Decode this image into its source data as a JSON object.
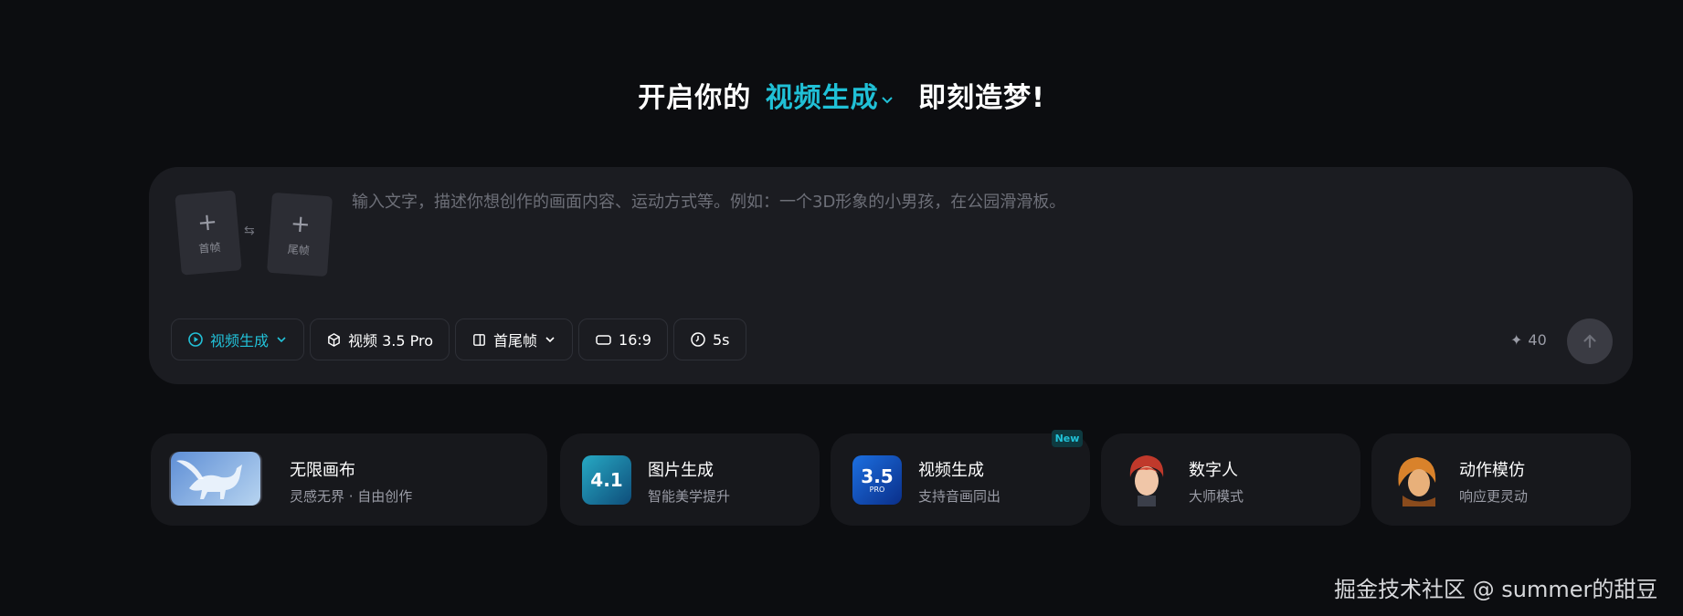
{
  "headline": {
    "prefix": "开启你的",
    "mode": "视频生成",
    "suffix": "即刻造梦!"
  },
  "composer": {
    "first_frame_label": "首帧",
    "last_frame_label": "尾帧",
    "prompt_placeholder": "输入文字，描述你想创作的画面内容、运动方式等。例如：一个3D形象的小男孩，在公园滑滑板。",
    "toolbar": {
      "mode": "视频生成",
      "model": "视频 3.5 Pro",
      "frames": "首尾帧",
      "ratio": "16:9",
      "duration": "5s"
    },
    "credits": "40"
  },
  "features": [
    {
      "title": "无限画布",
      "subtitle": "灵感无界 · 自由创作"
    },
    {
      "title": "图片生成",
      "subtitle": "智能美学提升",
      "thumb_text": "4.1"
    },
    {
      "title": "视频生成",
      "subtitle": "支持音画同出",
      "thumb_text": "3.5",
      "thumb_sub": "PRO",
      "badge": "New"
    },
    {
      "title": "数字人",
      "subtitle": "大师模式"
    },
    {
      "title": "动作模仿",
      "subtitle": "响应更灵动"
    }
  ],
  "watermark": "掘金技术社区 @ summer的甜豆",
  "colors": {
    "background": "#0c0d10",
    "panel": "#1b1c21",
    "accent": "#20c0d6"
  },
  "icons": [
    "plus-icon",
    "swap-icon",
    "video-play-icon",
    "chevron-down-icon",
    "cube-icon",
    "frames-icon",
    "aspect-ratio-icon",
    "timer-icon",
    "sparkle-icon",
    "arrow-up-icon"
  ]
}
